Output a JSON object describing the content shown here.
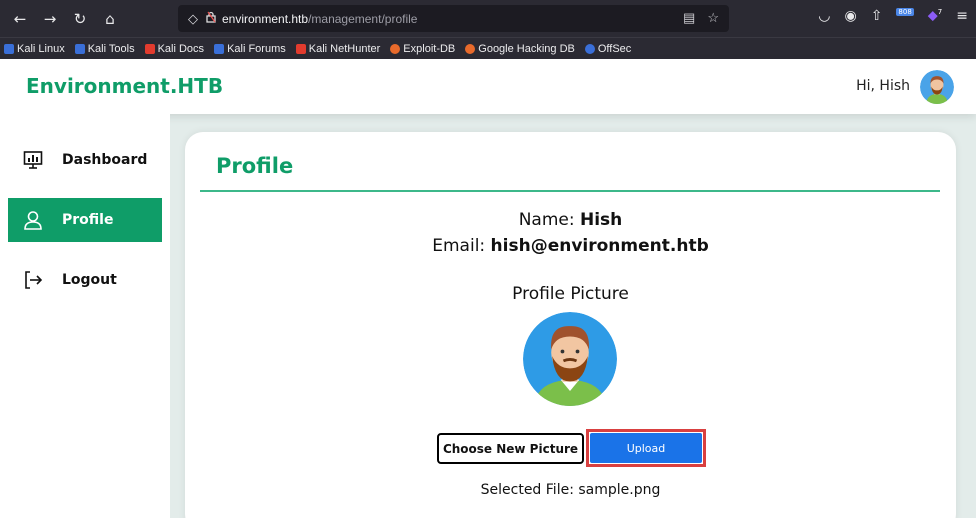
{
  "browser": {
    "url_host": "environment.htb",
    "url_path": "/management/profile",
    "extension_badge": "808",
    "extension_count": "7",
    "bookmarks": [
      {
        "label": "Kali Linux",
        "color": "#3a6fd8"
      },
      {
        "label": "Kali Tools",
        "color": "#3a6fd8"
      },
      {
        "label": "Kali Docs",
        "color": "#e23b2e"
      },
      {
        "label": "Kali Forums",
        "color": "#3a6fd8"
      },
      {
        "label": "Kali NetHunter",
        "color": "#e23b2e"
      },
      {
        "label": "Exploit-DB",
        "color": "#e86a2b"
      },
      {
        "label": "Google Hacking DB",
        "color": "#e86a2b"
      },
      {
        "label": "OffSec",
        "color": "#3a6fd8"
      }
    ]
  },
  "header": {
    "brand": "Environment.HTB",
    "greeting": "Hi, Hish"
  },
  "sidebar": {
    "items": [
      {
        "label": "Dashboard",
        "icon": "dashboard-icon",
        "active": false
      },
      {
        "label": "Profile",
        "icon": "user-icon",
        "active": true
      },
      {
        "label": "Logout",
        "icon": "logout-icon",
        "active": false
      }
    ]
  },
  "profile": {
    "title": "Profile",
    "name_label": "Name: ",
    "name_value": "Hish",
    "email_label": "Email: ",
    "email_value": "hish@environment.htb",
    "picture_label": "Profile Picture",
    "choose_button": "Choose New Picture",
    "upload_button": "Upload",
    "selected_file": "Selected File: sample.png"
  },
  "colors": {
    "brand_green": "#0f9d68",
    "upload_blue": "#1a73e8",
    "highlight_red": "#d94040"
  }
}
